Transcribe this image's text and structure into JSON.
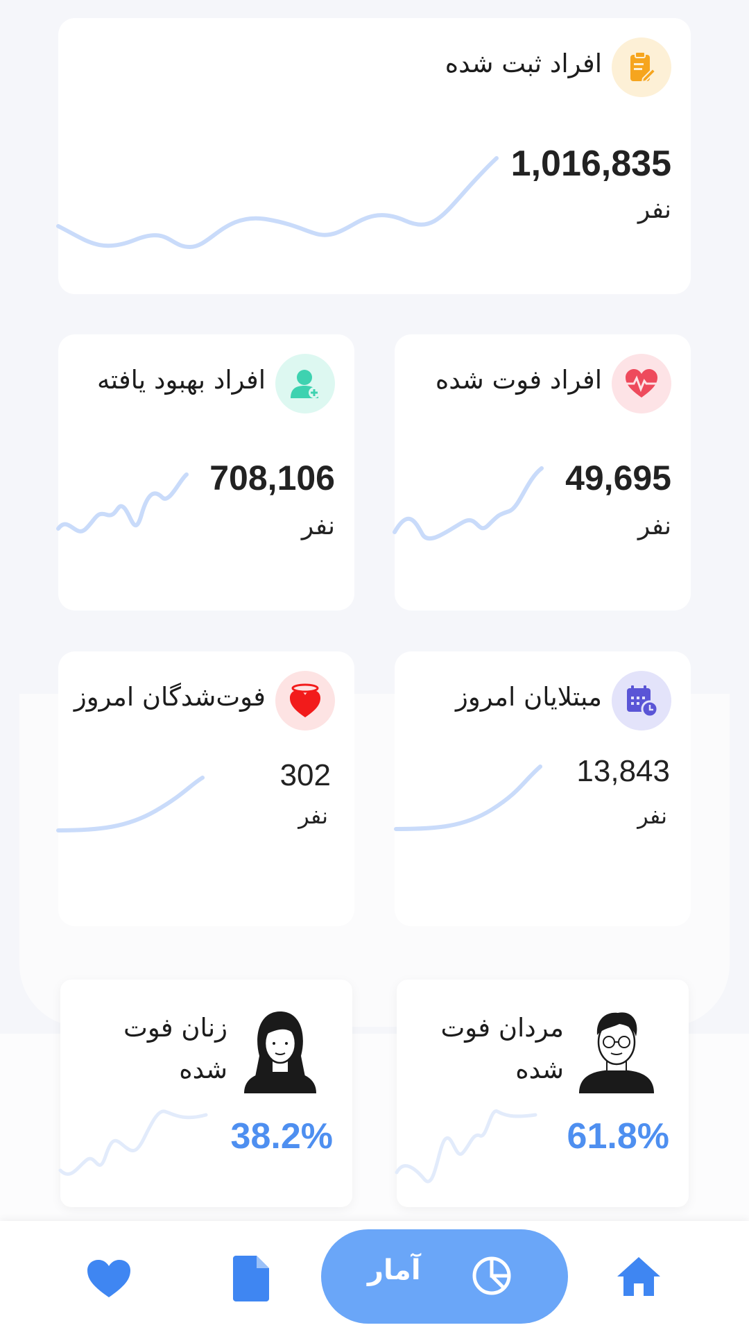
{
  "cards": {
    "registered": {
      "title": "افراد ثبت شده",
      "value": "1,016,835",
      "unit": "نفر",
      "icon": "clipboard-edit-icon",
      "icon_color": "#f6a51e"
    },
    "deceased": {
      "title": "افراد فوت شده",
      "value": "49,695",
      "unit": "نفر",
      "icon": "heart-pulse-icon",
      "icon_color": "#ee4a5c"
    },
    "recovered": {
      "title": "افراد بهبود یافته",
      "value": "708,106",
      "unit": "نفر",
      "icon": "nurse-icon",
      "icon_color": "#3ed2b0"
    },
    "infected_today": {
      "title": "مبتلایان امروز",
      "value": "13,843",
      "unit": "نفر",
      "icon": "calendar-clock-icon",
      "icon_color": "#5a55d6"
    },
    "deceased_today": {
      "title": "فوت‌شدگان امروز",
      "value": "302",
      "unit": "نفر",
      "icon": "halo-heart-icon",
      "icon_color": "#f21b1b"
    }
  },
  "gender": {
    "men": {
      "title_line1": "مردان فوت",
      "title_line2": "شده",
      "percent": "61.8%",
      "avatar": "man-avatar-icon"
    },
    "women": {
      "title_line1": "زنان فوت",
      "title_line2": "شده",
      "percent": "38.2%",
      "avatar": "woman-avatar-icon"
    }
  },
  "nav": {
    "items": [
      {
        "name": "home",
        "icon": "home-icon"
      },
      {
        "name": "stats",
        "label": "آمار",
        "icon": "pie-chart-icon",
        "active": true
      },
      {
        "name": "document",
        "icon": "document-icon"
      },
      {
        "name": "favorites",
        "icon": "heart-icon"
      }
    ]
  },
  "colors": {
    "accent": "#4e8ff0",
    "sparkline": "#c9dbfa",
    "nav_pill": "#6aa6f8",
    "nav_icon": "#3f86f2"
  }
}
